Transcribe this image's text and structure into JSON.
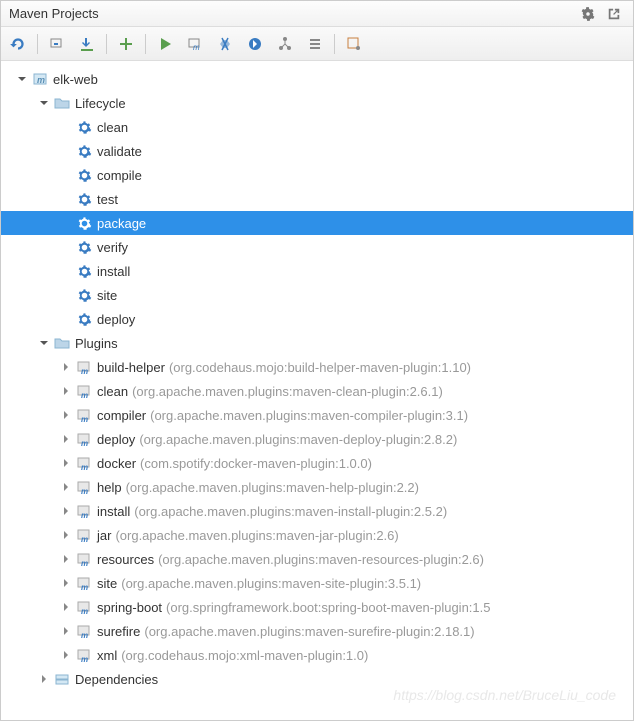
{
  "panel": {
    "title": "Maven Projects"
  },
  "tree": {
    "project": "elk-web",
    "lifecycle_label": "Lifecycle",
    "lifecycle": [
      {
        "name": "clean",
        "selected": false
      },
      {
        "name": "validate",
        "selected": false
      },
      {
        "name": "compile",
        "selected": false
      },
      {
        "name": "test",
        "selected": false
      },
      {
        "name": "package",
        "selected": true
      },
      {
        "name": "verify",
        "selected": false
      },
      {
        "name": "install",
        "selected": false
      },
      {
        "name": "site",
        "selected": false
      },
      {
        "name": "deploy",
        "selected": false
      }
    ],
    "plugins_label": "Plugins",
    "plugins": [
      {
        "name": "build-helper",
        "detail": "(org.codehaus.mojo:build-helper-maven-plugin:1.10)"
      },
      {
        "name": "clean",
        "detail": "(org.apache.maven.plugins:maven-clean-plugin:2.6.1)"
      },
      {
        "name": "compiler",
        "detail": "(org.apache.maven.plugins:maven-compiler-plugin:3.1)"
      },
      {
        "name": "deploy",
        "detail": "(org.apache.maven.plugins:maven-deploy-plugin:2.8.2)"
      },
      {
        "name": "docker",
        "detail": "(com.spotify:docker-maven-plugin:1.0.0)"
      },
      {
        "name": "help",
        "detail": "(org.apache.maven.plugins:maven-help-plugin:2.2)"
      },
      {
        "name": "install",
        "detail": "(org.apache.maven.plugins:maven-install-plugin:2.5.2)"
      },
      {
        "name": "jar",
        "detail": "(org.apache.maven.plugins:maven-jar-plugin:2.6)"
      },
      {
        "name": "resources",
        "detail": "(org.apache.maven.plugins:maven-resources-plugin:2.6)"
      },
      {
        "name": "site",
        "detail": "(org.apache.maven.plugins:maven-site-plugin:3.5.1)"
      },
      {
        "name": "spring-boot",
        "detail": "(org.springframework.boot:spring-boot-maven-plugin:1.5"
      },
      {
        "name": "surefire",
        "detail": "(org.apache.maven.plugins:maven-surefire-plugin:2.18.1)"
      },
      {
        "name": "xml",
        "detail": "(org.codehaus.mojo:xml-maven-plugin:1.0)"
      }
    ],
    "dependencies_label": "Dependencies"
  },
  "watermark": "https://blog.csdn.net/BruceLiu_code"
}
